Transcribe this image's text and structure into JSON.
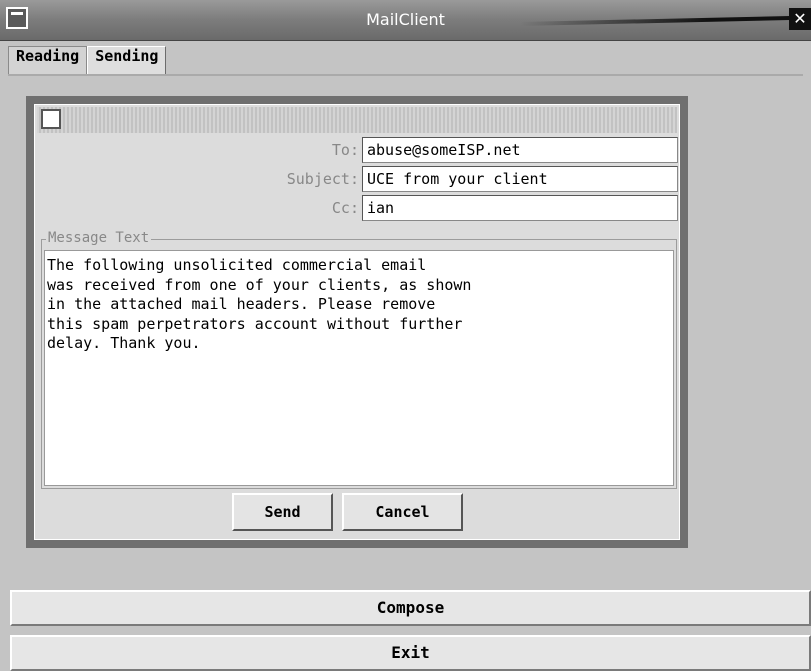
{
  "window": {
    "title": "MailClient"
  },
  "tabs": [
    {
      "label": "Reading",
      "active": false
    },
    {
      "label": "Sending",
      "active": true
    }
  ],
  "dialog": {
    "to_label": "To:",
    "to_value": "abuse@someISP.net",
    "subject_label": "Subject:",
    "subject_value": "UCE from your client",
    "cc_label": "Cc:",
    "cc_value": "ian",
    "message_label": "Message Text",
    "message_text": "The following unsolicited commercial email\nwas received from one of your clients, as shown\nin the attached mail headers. Please remove\nthis spam perpetrators account without further\ndelay. Thank you.",
    "send_label": "Send",
    "cancel_label": "Cancel"
  },
  "actions": {
    "compose_label": "Compose",
    "exit_label": "Exit"
  },
  "icons": {
    "window_menu": "window-menu-icon",
    "close": "close-icon",
    "dialog_menu": "dialog-menu-icon"
  }
}
